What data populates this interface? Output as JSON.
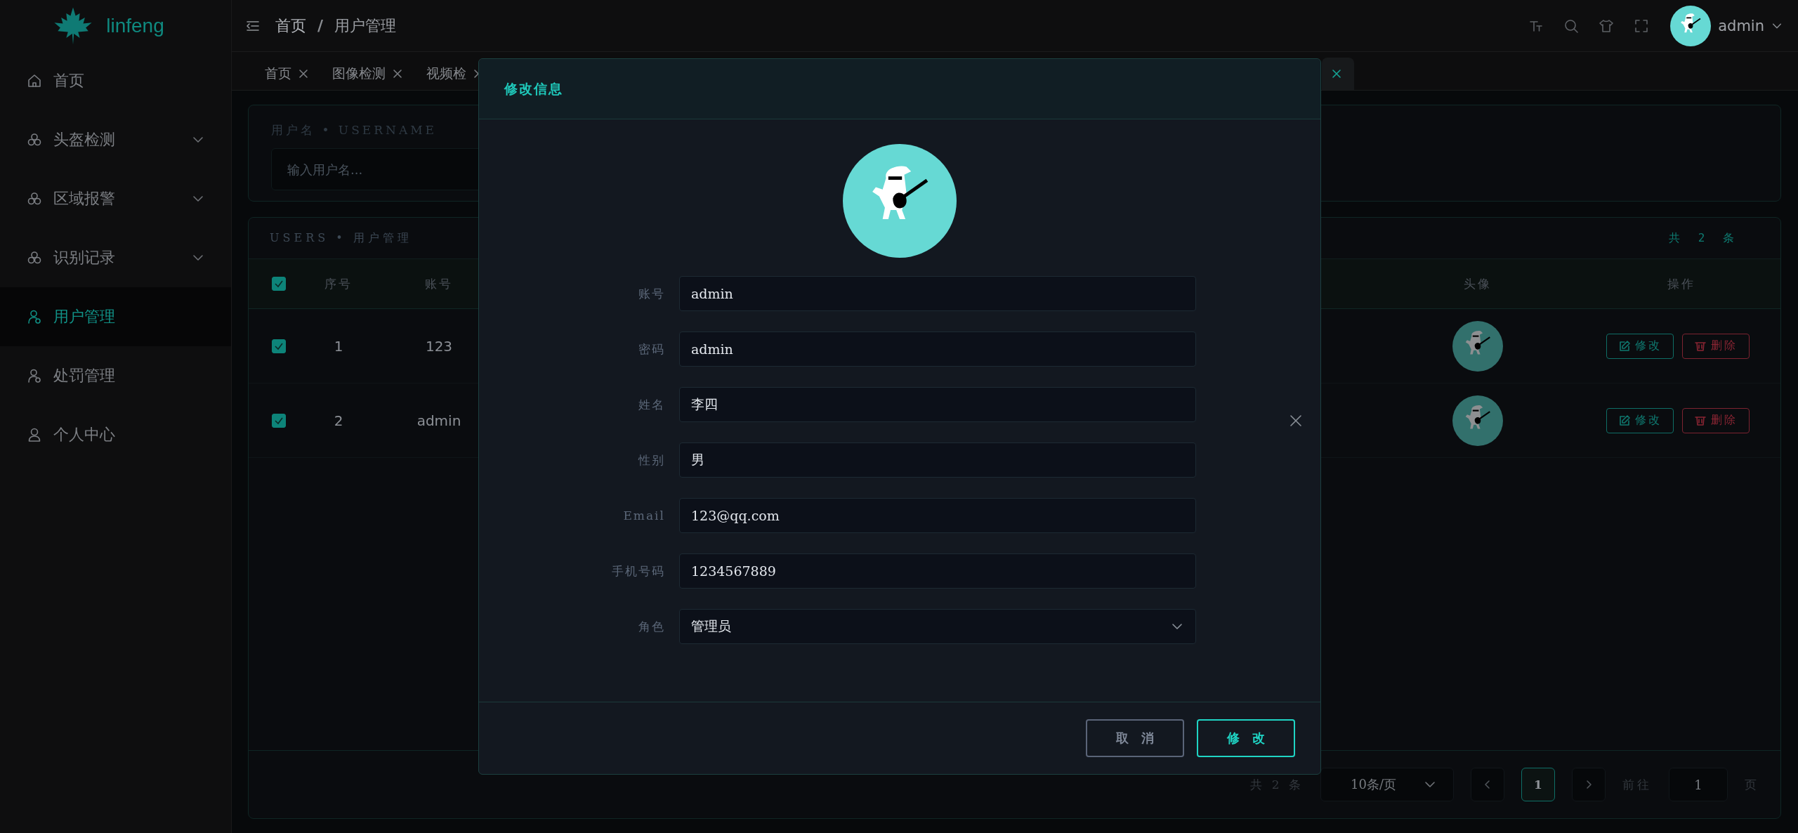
{
  "sidebar": {
    "logo_text": "linfeng",
    "items": [
      {
        "label": "首页",
        "kind": "home",
        "expandable": false,
        "selected": false
      },
      {
        "label": "头盔检测",
        "kind": "cluster",
        "expandable": true,
        "selected": false
      },
      {
        "label": "区域报警",
        "kind": "cluster",
        "expandable": true,
        "selected": false
      },
      {
        "label": "识别记录",
        "kind": "cluster",
        "expandable": true,
        "selected": false
      },
      {
        "label": "用户管理",
        "kind": "user",
        "expandable": false,
        "selected": true
      },
      {
        "label": "处罚管理",
        "kind": "user",
        "expandable": false,
        "selected": false
      },
      {
        "label": "个人中心",
        "kind": "person",
        "expandable": false,
        "selected": false
      }
    ]
  },
  "header": {
    "breadcrumb": [
      "首页",
      "用户管理"
    ],
    "separator": "/",
    "user": "admin"
  },
  "tabs": [
    {
      "label": "首页",
      "selected": false
    },
    {
      "label": "图像检测",
      "selected": false
    },
    {
      "label": "视频检",
      "selected": false
    },
    {
      "selected": true
    }
  ],
  "search_card": {
    "label": "用户名 • USERNAME",
    "placeholder": "输入用户名..."
  },
  "table_card": {
    "title": "USERS • 用户管理",
    "count": "共 2 条",
    "columns": [
      "序号",
      "账号",
      "头像",
      "操作"
    ],
    "all_checked": true,
    "rows": [
      {
        "checked": true,
        "index": "1",
        "account": "123",
        "edit": "修改",
        "delete": "删除"
      },
      {
        "checked": true,
        "index": "2",
        "account": "admin",
        "edit": "修改",
        "delete": "删除"
      }
    ]
  },
  "pagination": {
    "total": "共 2 条",
    "page_size": "10条/页",
    "pages": [
      {
        "label": "1",
        "selected": true
      }
    ],
    "goto_label": "前往",
    "goto_value": "1",
    "page_suffix": "页"
  },
  "dialog": {
    "title": "修改信息",
    "fields": [
      {
        "label": "账号",
        "value": "admin",
        "kind": "input"
      },
      {
        "label": "密码",
        "value": "admin",
        "kind": "input"
      },
      {
        "label": "姓名",
        "value": "李四",
        "kind": "input"
      },
      {
        "label": "性别",
        "value": "男",
        "kind": "input"
      },
      {
        "label": "Email",
        "value": "123@qq.com",
        "kind": "input"
      },
      {
        "label": "手机号码",
        "value": "1234567889",
        "kind": "input"
      },
      {
        "label": "角色",
        "value": "管理员",
        "kind": "select"
      }
    ],
    "buttons": [
      {
        "label": "取消",
        "kind": "cancel"
      },
      {
        "label": "修改",
        "kind": "primary"
      }
    ]
  }
}
